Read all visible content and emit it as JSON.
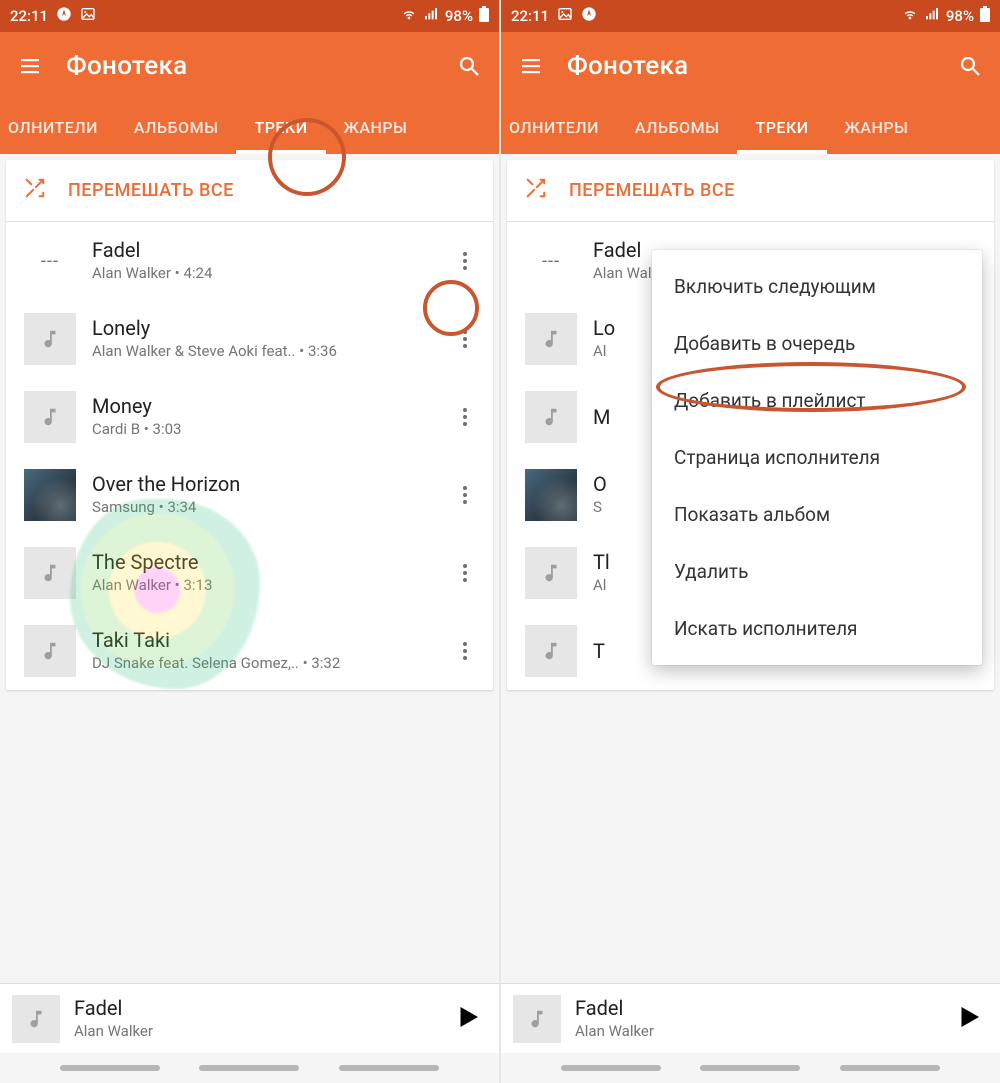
{
  "status": {
    "time": "22:11",
    "battery": "98%"
  },
  "appbar": {
    "title": "Фонотека"
  },
  "tabs": {
    "artists": "ОЛНИТЕЛИ",
    "albums": "АЛЬБОМЫ",
    "tracks": "ТРЕКИ",
    "genres": "ЖАНРЫ",
    "active": "tracks"
  },
  "shuffle": {
    "label": "ПЕРЕМЕШАТЬ ВСЕ"
  },
  "tracks": [
    {
      "title": "Fadel",
      "subtitle": "Alan Walker • 4:24",
      "thumb": "dashes"
    },
    {
      "title": "Lonely",
      "subtitle": "Alan Walker & Steve Aoki feat.. • 3:36",
      "thumb": "note"
    },
    {
      "title": "Money",
      "subtitle": "Cardi B • 3:03",
      "thumb": "note"
    },
    {
      "title": "Over the Horizon",
      "subtitle": "Samsung • 3:34",
      "thumb": "special"
    },
    {
      "title": "The Spectre",
      "subtitle": "Alan Walker • 3:13",
      "thumb": "note"
    },
    {
      "title": "Taki Taki",
      "subtitle": "DJ Snake feat. Selena Gomez,.. • 3:32",
      "thumb": "note"
    }
  ],
  "tracks_short": [
    {
      "title": "Lo",
      "subtitle": "Al"
    },
    {
      "title": "M"
    },
    {
      "title": "O",
      "subtitle": "S"
    },
    {
      "title": "Tl",
      "subtitle": "Al"
    },
    {
      "title": "T"
    }
  ],
  "now_playing": {
    "title": "Fadel",
    "subtitle": "Alan Walker"
  },
  "menu": {
    "items": [
      "Включить следующим",
      "Добавить в очередь",
      "Добавить в плейлист",
      "Страница исполнителя",
      "Показать альбом",
      "Удалить",
      "Искать исполнителя"
    ]
  }
}
